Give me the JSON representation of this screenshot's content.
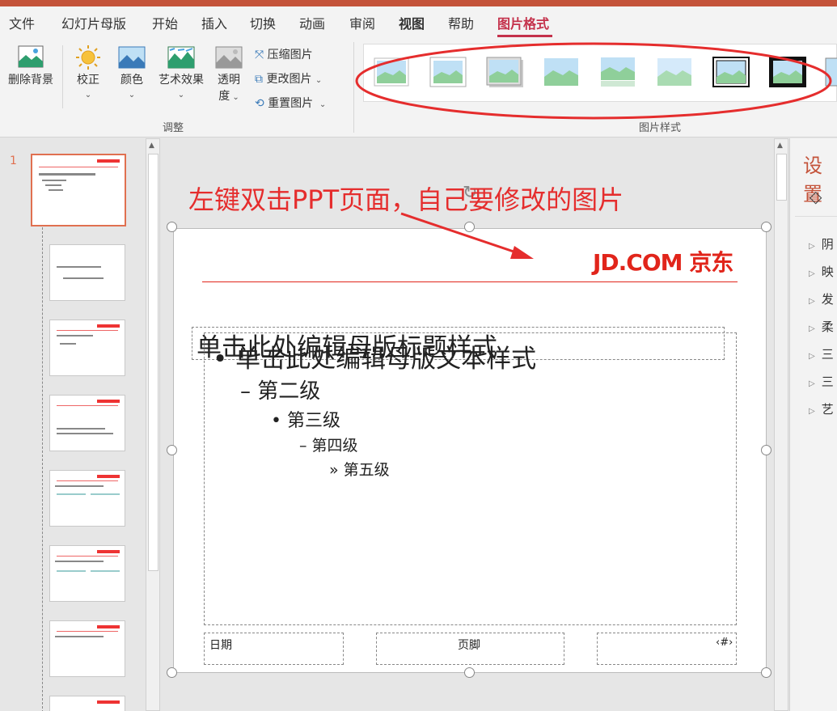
{
  "tabs": [
    {
      "label": "文件"
    },
    {
      "label": "幻灯片母版"
    },
    {
      "label": "开始"
    },
    {
      "label": "插入"
    },
    {
      "label": "切换"
    },
    {
      "label": "动画"
    },
    {
      "label": "审阅"
    },
    {
      "label": "视图"
    },
    {
      "label": "帮助"
    },
    {
      "label": "图片格式"
    }
  ],
  "ribbon": {
    "remove_bg": "删除背景",
    "correct": "校正",
    "color": "颜色",
    "art_effect": "艺术效果",
    "transparency_1": "透明",
    "transparency_2": "度",
    "compress": "压缩图片",
    "change": "更改图片",
    "reset": "重置图片",
    "group_adjust": "调整",
    "group_styles": "图片样式"
  },
  "thumbnails": {
    "slide_number": "1"
  },
  "slide": {
    "logo": "JD.COM 京东",
    "title_placeholder": "单击此处编辑母版标题样式",
    "body_level1": "单击此处编辑母版文本样式",
    "body_level2": "第二级",
    "body_level3": "第三级",
    "body_level4": "第四级",
    "body_level5": "第五级",
    "date": "日期",
    "footer": "页脚",
    "page_num": "‹#›"
  },
  "annotation": {
    "text": "左键双击PPT页面，自己要修改的图片",
    "color": "#e52d2d"
  },
  "right_pane": {
    "title": "设置",
    "items": [
      "阴",
      "映",
      "发",
      "柔",
      "三",
      "三",
      "艺"
    ]
  },
  "colors": {
    "accent": "#c4314b",
    "title_bar": "#c4533a",
    "jd_red": "#e1251b"
  }
}
